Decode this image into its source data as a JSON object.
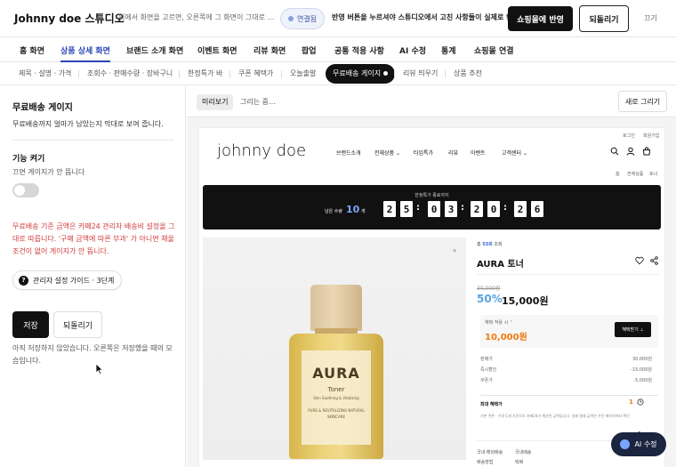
{
  "topbar": {
    "brand": "Johnny doe 스튜디오",
    "tagline": "위에서 화면을 고르면, 오른쪽에 그 화면이 그대로 보여요",
    "connection": "연결됨",
    "message": "반영 버튼을 누르셔야 스튜디오에서 고친 사항들이 실제로 반영됩니다",
    "apply_button": "쇼핑몰에 반영",
    "revert_button": "되돌리기",
    "close_button": "끄기"
  },
  "main_tabs": [
    {
      "label": "홈 화면"
    },
    {
      "label": "상품 상세 화면"
    },
    {
      "label": "브랜드 소개 화면"
    },
    {
      "label": "이벤트 화면"
    },
    {
      "label": "리뷰 화면"
    },
    {
      "label": "팝업"
    },
    {
      "label": "공통 적용 사항"
    },
    {
      "label": "AI 수정"
    },
    {
      "label": "통계"
    },
    {
      "label": "쇼핑몰 연결"
    }
  ],
  "main_tabs_active": 1,
  "sub_tabs": [
    {
      "label": "제목 · 설명 · 가격"
    },
    {
      "label": "조회수 · 판매수량 · 장바구니"
    },
    {
      "label": "한정특가 바"
    },
    {
      "label": "쿠폰 혜택가"
    },
    {
      "label": "오늘출발"
    },
    {
      "label": "무료배송 게이지"
    },
    {
      "label": "리뷰 띄우기"
    },
    {
      "label": "상품 추천"
    }
  ],
  "sub_tabs_active": 5,
  "left_panel": {
    "title": "무료배송 게이지",
    "description": "무료배송까지 얼마가 남았는지 막대로 보여 줍니다.",
    "feature_title": "기능 켜기",
    "feature_desc": "끄면 게이지가 안 뜹니다",
    "toggle_on": false,
    "warning": "무료배송 기준 금액은 카페24 관리자 배송비 설정을 그대로 따릅니다. '구매 금액에 따른 부과' 가 아니면 채울 조건이 없어 게이지가 안 뜹니다.",
    "guide_icon": "?",
    "guide_label": "관리자 설정 가이드 · 3단계",
    "save_button": "저장",
    "revert_button": "되돌리기",
    "note": "아직 저장하지 않았습니다. 오른쪽은 저장했을 때의 모습입니다."
  },
  "preview": {
    "tab_active": "미리보기",
    "tab_loading": "그리는 중…",
    "refresh_button": "새로 그리기"
  },
  "site": {
    "util_links": [
      "로그인",
      "회원가입"
    ],
    "logo": "johnny  doe",
    "nav": [
      "브랜드소개",
      "전체상품 ⌄",
      "타임특가",
      "리뷰",
      "이벤트",
      "고객센터 ⌄"
    ],
    "breadcrumb": [
      "홈",
      "전체상품",
      "토너"
    ],
    "banner_title": "한정특가 종료까지",
    "banner_qty_label": "남은 수량",
    "banner_qty": "10",
    "banner_qty_unit": "개",
    "countdown": [
      "2",
      "5",
      "0",
      "3",
      "2",
      "0",
      "2",
      "6"
    ],
    "zoom_icon": "+",
    "bottle_label_brand": "AURA",
    "bottle_label_product": "Toner",
    "bottle_label_sub": "Skin Soothing & Vitalizing",
    "bottle_label_detail": "PURE & REVITALIZING  NATURAL SKINCARE",
    "views_prefix": "총",
    "views_count": "53회",
    "views_suffix": "조회",
    "product_name": "AURA 토너",
    "original_price": "30,000원",
    "discount_rate": "50%",
    "price": "15,000원",
    "coupon_label": "혜택 적용 시 ⌃",
    "coupon_price": "10,000원",
    "coupon_button": "혜택받기 ⊥",
    "breakdown": [
      {
        "label": "판매가",
        "value": "30,000원"
      },
      {
        "label": "즉시할인",
        "value": "-15,000원"
      },
      {
        "label": "쿠폰가",
        "value": "-5,000원"
      }
    ],
    "max_benefit_label": "최대 혜택가",
    "max_benefit_value": "1",
    "max_benefit_desc": "기본 쿠폰 · 수량 1개 기준으로 카페24가 계산한 금액입니다. 실제 결제 금액은 주문 페이지에서 확인",
    "scroll_up": "↑",
    "footer_labels": [
      "국내·해외배송",
      "국내배송"
    ],
    "footer_labels2": [
      "배송방법",
      "택배"
    ]
  },
  "ai_button": "AI 수정",
  "colors": {
    "accent": "#2a47b8",
    "warning": "#d23b3b",
    "discount": "#5aa3e0",
    "coupon": "#f07a10"
  }
}
